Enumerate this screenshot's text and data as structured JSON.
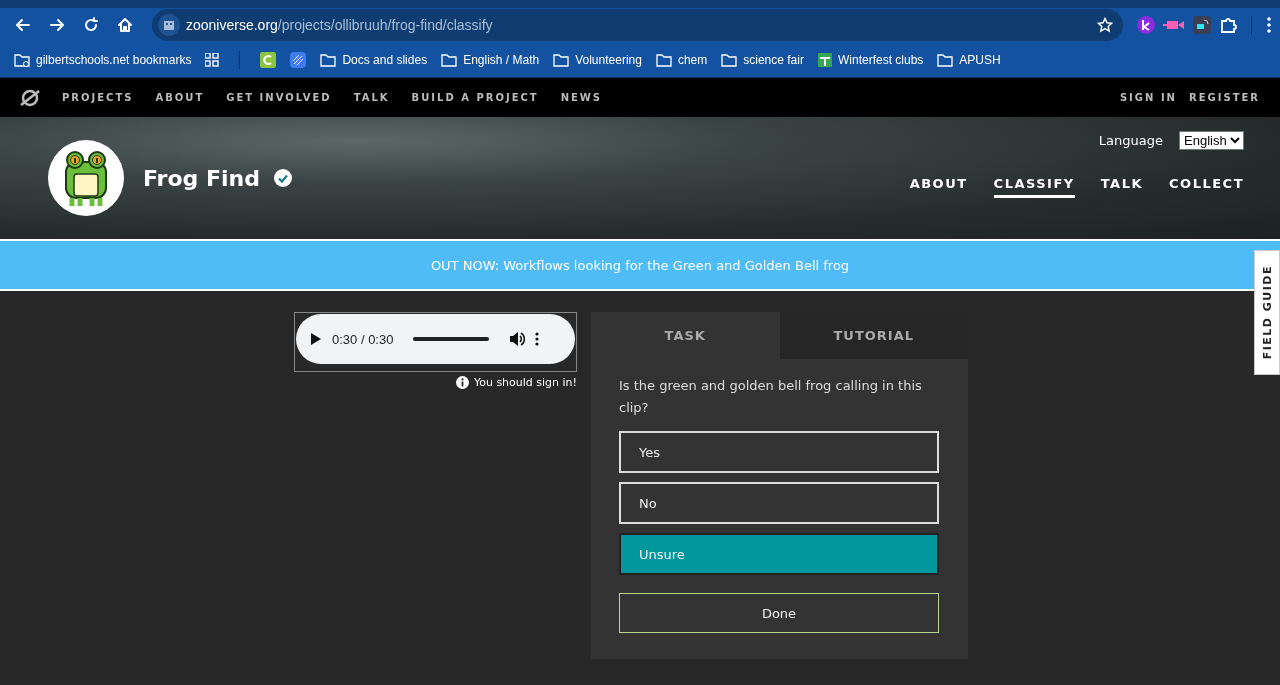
{
  "browser": {
    "url_host": "zooniverse.org",
    "url_path": "/projects/ollibruuh/frog-find/classify",
    "bookmarks": [
      {
        "kind": "manager",
        "label": "gilbertschools.net bookmarks"
      },
      {
        "kind": "apps"
      },
      {
        "kind": "app-c"
      },
      {
        "kind": "app-stripe"
      },
      {
        "kind": "folder",
        "label": "Docs and slides"
      },
      {
        "kind": "folder",
        "label": "English / Math"
      },
      {
        "kind": "folder",
        "label": "Volunteering"
      },
      {
        "kind": "folder",
        "label": "chem"
      },
      {
        "kind": "folder",
        "label": "science fair"
      },
      {
        "kind": "app-cross",
        "label": "Winterfest clubs"
      },
      {
        "kind": "folder",
        "label": "APUSH"
      }
    ]
  },
  "site_nav": {
    "items": [
      "PROJECTS",
      "ABOUT",
      "GET INVOLVED",
      "TALK",
      "BUILD A PROJECT",
      "NEWS"
    ],
    "account": [
      "SIGN IN",
      "REGISTER"
    ]
  },
  "project": {
    "name": "Frog Find",
    "verified": true,
    "language_label": "Language",
    "language_value": "English",
    "nav": [
      {
        "label": "ABOUT",
        "selected": false
      },
      {
        "label": "CLASSIFY",
        "selected": true
      },
      {
        "label": "TALK",
        "selected": false
      },
      {
        "label": "COLLECT",
        "selected": false
      }
    ]
  },
  "banner": "OUT NOW: Workflows looking for the Green and Golden Bell frog",
  "audio": {
    "time": "0:30 / 0:30",
    "level": 1
  },
  "sign_in_note": "You should sign in!",
  "task": {
    "tabs": [
      {
        "label": "TASK",
        "selected": true
      },
      {
        "label": "TUTORIAL",
        "selected": false
      }
    ],
    "question": "Is the green and golden bell frog calling in this clip?",
    "answers": [
      {
        "label": "Yes",
        "selected": false
      },
      {
        "label": "No",
        "selected": false
      },
      {
        "label": "Unsure",
        "selected": true
      }
    ],
    "done": "Done"
  },
  "field_guide": "FIELD GUIDE"
}
